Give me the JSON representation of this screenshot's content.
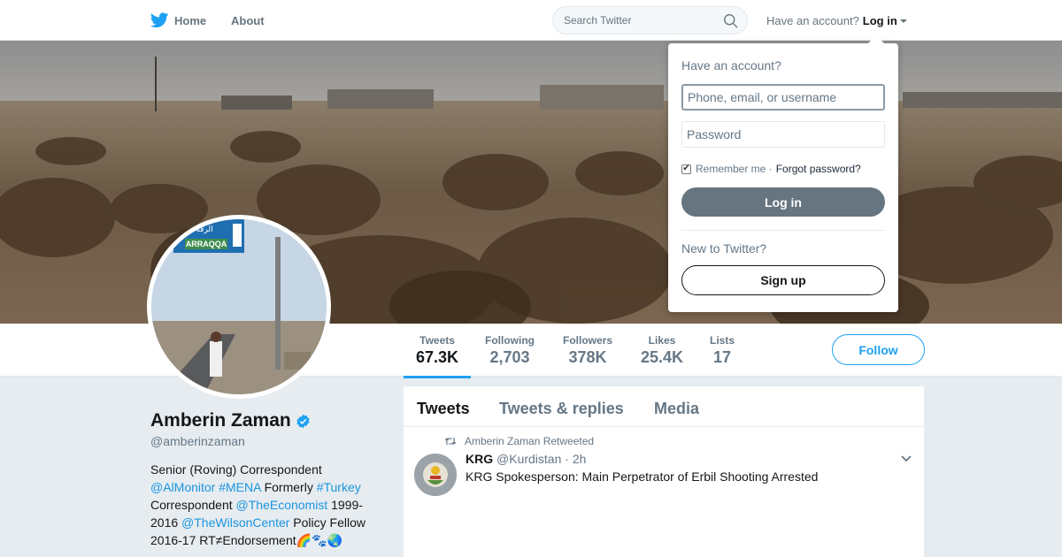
{
  "nav": {
    "home_label": "Home",
    "about_label": "About",
    "search_placeholder": "Search Twitter",
    "have_account": "Have an account?",
    "login_label": "Log in"
  },
  "banner": {
    "sign_text": "ARRAQQA",
    "arabic_text": "الرقة"
  },
  "profile": {
    "name": "Amberin Zaman",
    "handle": "@amberinzaman",
    "bio": {
      "p1": "Senior (Roving) Correspondent ",
      "l1": "@AlMonitor",
      "p2": " ",
      "l2": "#MENA",
      "p3": " Formerly ",
      "l3": "#Turkey",
      "p4": " Correspondent ",
      "l4": "@TheEconomist",
      "p5": " 1999-2016 ",
      "l5": "@TheWilsonCenter",
      "p6": " Policy Fellow 2016-17 RT≠Endorsement🌈🐾🌏"
    }
  },
  "stats": [
    {
      "label": "Tweets",
      "value": "67.3K"
    },
    {
      "label": "Following",
      "value": "2,703"
    },
    {
      "label": "Followers",
      "value": "378K"
    },
    {
      "label": "Likes",
      "value": "25.4K"
    },
    {
      "label": "Lists",
      "value": "17"
    }
  ],
  "follow_label": "Follow",
  "timeline": {
    "tabs": [
      "Tweets",
      "Tweets & replies",
      "Media"
    ],
    "tweet": {
      "retweet_context": "Amberin Zaman Retweeted",
      "author_name": "KRG",
      "author_handle": "@Kurdistan",
      "time": "· 2h",
      "text": "KRG Spokesperson: Main Perpetrator of Erbil Shooting Arrested"
    }
  },
  "login_dropdown": {
    "title": "Have an account?",
    "username_placeholder": "Phone, email, or username",
    "password_placeholder": "Password",
    "remember_me": "Remember me ·",
    "forgot_password": "Forgot password?",
    "login_button": "Log in",
    "new_to_twitter": "New to Twitter?",
    "signup_button": "Sign up"
  },
  "colors": {
    "brand": "#1da1f2",
    "link": "#1b95e0",
    "background": "#e6ecf0"
  },
  "icons": [
    "twitter-bird-icon",
    "search-icon",
    "caret-down-icon",
    "verified-badge-icon",
    "retweet-icon",
    "chevron-down-icon"
  ]
}
